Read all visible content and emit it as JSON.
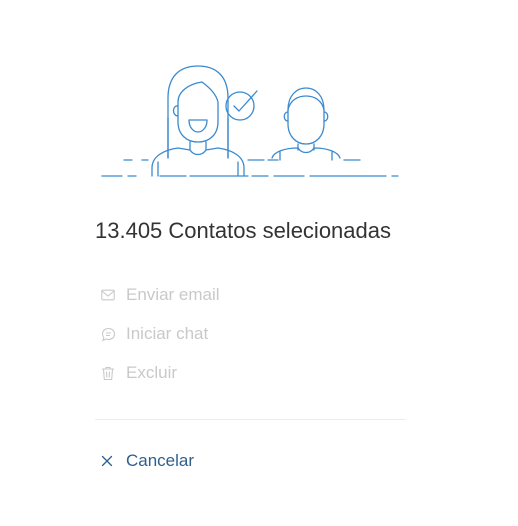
{
  "summary": {
    "title": "13.405 Contatos selecionadas"
  },
  "actions": [
    {
      "label": "Enviar email",
      "icon": "envelope-icon",
      "enabled": false
    },
    {
      "label": "Iniciar chat",
      "icon": "chat-bubble-icon",
      "enabled": false
    },
    {
      "label": "Excluir",
      "icon": "trash-icon",
      "enabled": false
    }
  ],
  "cancel": {
    "label": "Cancelar",
    "icon": "close-icon"
  },
  "colors": {
    "illustration_stroke": "#3a8ad0",
    "title_text": "#333333",
    "disabled_text": "#c9c9c9",
    "cancel_text": "#2f5f8f",
    "divider": "#ececec"
  }
}
